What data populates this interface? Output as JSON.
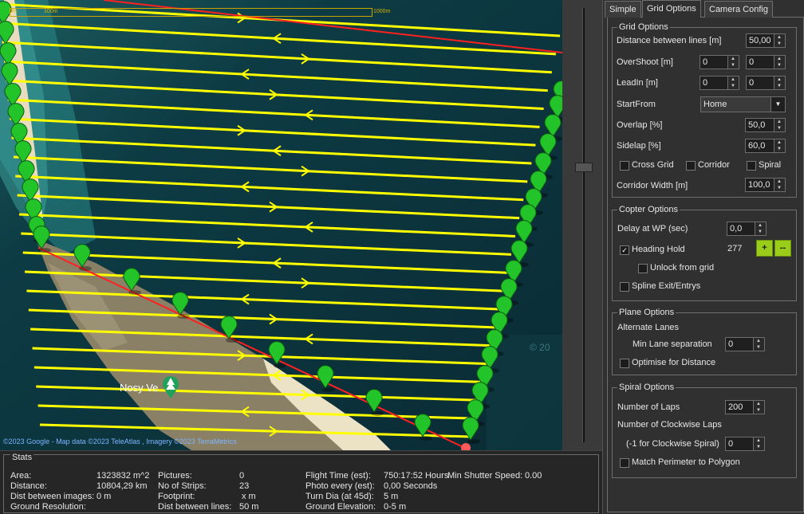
{
  "map": {
    "credit": "©2023 Google - Map data ©2023 TeleAtlas , Imagery ©2023 TerraMetrics",
    "place_label": "Nosy Ve",
    "watermark": "© 20",
    "scale_start": "0m",
    "scale_mid": "100m",
    "scale_end": "1000m"
  },
  "stats": {
    "title": "Stats",
    "col1": [
      {
        "label": "Area:",
        "value": "1323832 m^2"
      },
      {
        "label": "Distance:",
        "value": "10804,29 km"
      },
      {
        "label": "Dist between images:",
        "value": "0 m"
      },
      {
        "label": "Ground Resolution:",
        "value": ""
      }
    ],
    "col2": [
      {
        "label": "Pictures:",
        "value": "0"
      },
      {
        "label": "No of Strips:",
        "value": "23"
      },
      {
        "label": "Footprint:",
        "value": "x  m"
      },
      {
        "label": "Dist between lines:",
        "value": "50 m"
      }
    ],
    "col3": [
      {
        "label": "Flight Time (est):",
        "value": "750:17:52 Hours"
      },
      {
        "label": "Photo every (est):",
        "value": "0,00 Seconds"
      },
      {
        "label": "Turn Dia (at 45d):",
        "value": "5 m"
      },
      {
        "label": "Ground Elevation:",
        "value": "0-5 m"
      }
    ],
    "shutter_label": "Min Shutter Speed:",
    "shutter_value": "0.00"
  },
  "tabs": [
    "Simple",
    "Grid Options",
    "Camera Config"
  ],
  "grid_options": {
    "title": "Grid Options",
    "distance_label": "Distance between lines [m]",
    "distance_value": "50,00",
    "overshoot_label": "OverShoot [m]",
    "overshoot_1": "0",
    "overshoot_2": "0",
    "leadin_label": "LeadIn [m]",
    "leadin_1": "0",
    "leadin_2": "0",
    "startfrom_label": "StartFrom",
    "startfrom_value": "Home",
    "overlap_label": "Overlap [%]",
    "overlap_value": "50,0",
    "sidelap_label": "Sidelap [%]",
    "sidelap_value": "60,0",
    "crossgrid_label": "Cross Grid",
    "corridor_label": "Corridor",
    "spiral_label": "Spiral",
    "corridor_width_label": "Corridor Width [m]",
    "corridor_width_value": "100,0"
  },
  "copter_options": {
    "title": "Copter Options",
    "delay_label": "Delay at WP (sec)",
    "delay_value": "0,0",
    "heading_hold_label": "Heading Hold",
    "heading_value": "277",
    "plus_label": "+",
    "minus_label": "--",
    "unlock_label": "Unlock from grid",
    "spline_label": "Spline Exit/Entrys"
  },
  "plane_options": {
    "title": "Plane Options",
    "alternate_label": "Alternate Lanes",
    "min_lane_label": "Min Lane separation",
    "min_lane_value": "0",
    "optimise_label": "Optimise for Distance"
  },
  "spiral_options": {
    "title": "Spiral Options",
    "laps_label": "Number of Laps",
    "laps_value": "200",
    "clockwise_label": "Number of Clockwise Laps",
    "clockwise_hint": "(-1 for Clockwise Spiral)",
    "clockwise_value": "0",
    "match_label": "Match Perimeter to Polygon"
  },
  "colors": {
    "flight_line": "#ffff00",
    "boundary": "#ff2020",
    "waypoint": "#22c42a",
    "panel_bg": "#303030",
    "button_green": "#9acd1a"
  }
}
